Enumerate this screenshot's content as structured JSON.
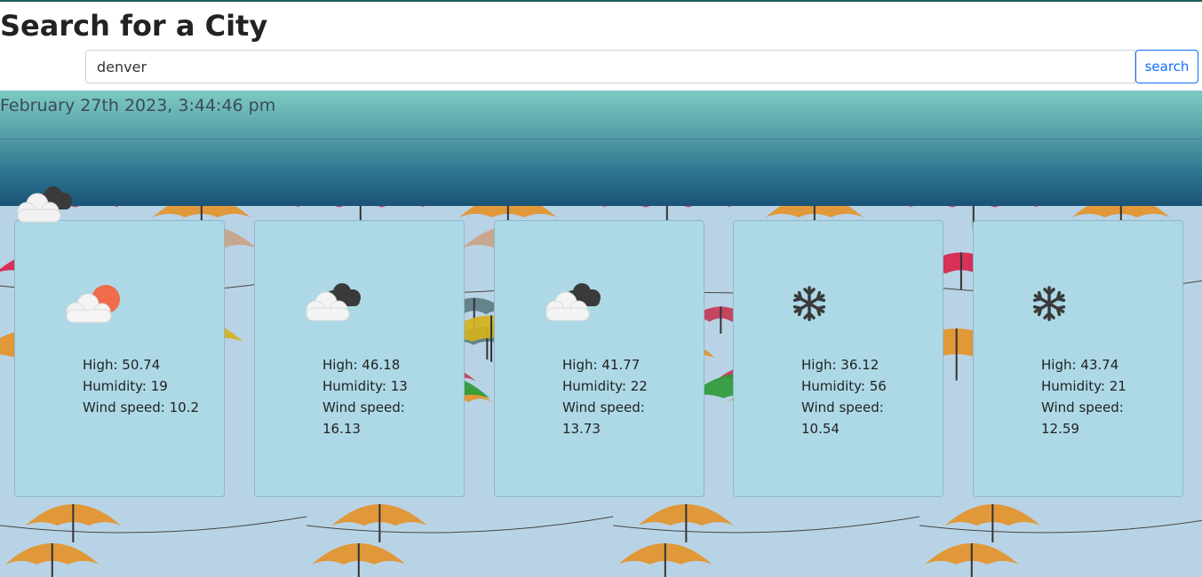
{
  "page": {
    "title": "Search for a City"
  },
  "search": {
    "value": "denver",
    "button_label": "search"
  },
  "header": {
    "timestamp": "February 27th 2023, 3:44:46 pm",
    "current_icon": "dark-clouds-icon"
  },
  "forecast": [
    {
      "icon": "partly-cloudy-icon",
      "high_label": "High: 50.74",
      "humidity_label": "Humidity: 19",
      "wind_label": "Wind speed: 10.2"
    },
    {
      "icon": "dark-clouds-icon",
      "high_label": "High: 46.18",
      "humidity_label": "Humidity: 13",
      "wind_label": "Wind speed: 16.13"
    },
    {
      "icon": "dark-clouds-icon",
      "high_label": "High: 41.77",
      "humidity_label": "Humidity: 22",
      "wind_label": "Wind speed: 13.73"
    },
    {
      "icon": "snowflake-icon",
      "high_label": "High: 36.12",
      "humidity_label": "Humidity: 56",
      "wind_label": "Wind speed: 10.54"
    },
    {
      "icon": "snowflake-icon",
      "high_label": "High: 43.74",
      "humidity_label": "Humidity: 21",
      "wind_label": "Wind speed: 12.59"
    }
  ],
  "colors": {
    "card_background": "#add8e6",
    "accent": "#0d6efd",
    "header_top": "#7dcbc3",
    "header_bottom": "#1a5377"
  }
}
